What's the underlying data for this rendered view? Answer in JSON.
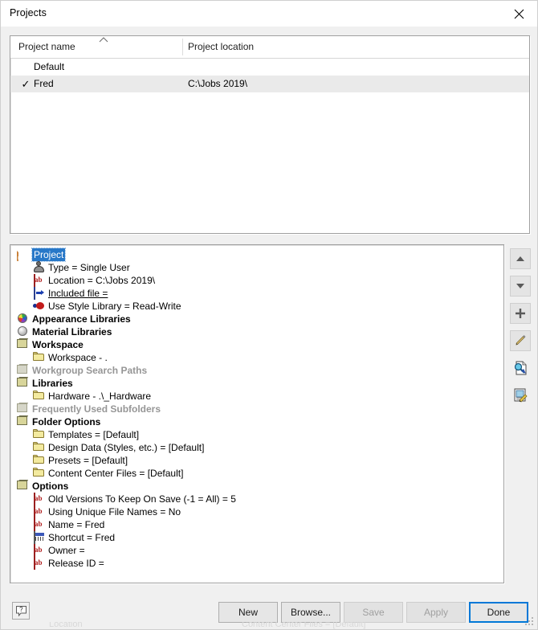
{
  "window": {
    "title": "Projects",
    "close_icon": "close-icon"
  },
  "project_list": {
    "columns": [
      "Project name",
      "Project location"
    ],
    "sort_indicator": "chevron-up-icon",
    "rows": [
      {
        "check": "",
        "name": "Default",
        "location": "",
        "selected": false
      },
      {
        "check": "✓",
        "name": "Fred",
        "location": "C:\\Jobs 2019\\",
        "selected": true
      }
    ]
  },
  "tree": {
    "nodes": [
      {
        "label": "Project",
        "indent": 0,
        "icon": "ipj-file-icon",
        "expander": "none",
        "style": "selected"
      },
      {
        "label": "Type = Single User",
        "indent": 1,
        "icon": "user-icon",
        "expander": "none",
        "style": "normal"
      },
      {
        "label": "Location = C:\\Jobs 2019\\",
        "indent": 1,
        "icon": "ab-text-icon",
        "expander": "none",
        "style": "normal"
      },
      {
        "label": "Included file =",
        "indent": 1,
        "icon": "included-file-icon",
        "expander": "none",
        "style": "link"
      },
      {
        "label": "Use Style Library = Read-Write",
        "indent": 1,
        "icon": "style-library-icon",
        "expander": "none",
        "style": "normal"
      },
      {
        "label": "Appearance Libraries",
        "indent": 0,
        "icon": "color-sphere-icon",
        "expander": "plus",
        "style": "bold"
      },
      {
        "label": "Material Libraries",
        "indent": 0,
        "icon": "gray-sphere-icon",
        "expander": "plus",
        "style": "bold"
      },
      {
        "label": "Workspace",
        "indent": 0,
        "icon": "box-icon",
        "expander": "minus",
        "style": "bold"
      },
      {
        "label": "Workspace - .",
        "indent": 1,
        "icon": "folder-icon",
        "expander": "none",
        "style": "normal"
      },
      {
        "label": "Workgroup Search Paths",
        "indent": 0,
        "icon": "box-icon-dim",
        "expander": "none",
        "style": "dim"
      },
      {
        "label": "Libraries",
        "indent": 0,
        "icon": "box-icon",
        "expander": "minus",
        "style": "bold"
      },
      {
        "label": "Hardware - .\\_Hardware",
        "indent": 1,
        "icon": "folder-icon",
        "expander": "none",
        "style": "normal"
      },
      {
        "label": "Frequently Used Subfolders",
        "indent": 0,
        "icon": "box-icon-dim",
        "expander": "none",
        "style": "dim"
      },
      {
        "label": "Folder Options",
        "indent": 0,
        "icon": "box-icon",
        "expander": "minus",
        "style": "bold"
      },
      {
        "label": "Templates = [Default]",
        "indent": 1,
        "icon": "folder-icon",
        "expander": "none",
        "style": "normal"
      },
      {
        "label": "Design Data (Styles, etc.) = [Default]",
        "indent": 1,
        "icon": "folder-icon",
        "expander": "none",
        "style": "normal"
      },
      {
        "label": "Presets = [Default]",
        "indent": 1,
        "icon": "folder-icon",
        "expander": "none",
        "style": "normal"
      },
      {
        "label": "Content Center Files = [Default]",
        "indent": 1,
        "icon": "folder-icon",
        "expander": "none",
        "style": "normal"
      },
      {
        "label": "Options",
        "indent": 0,
        "icon": "box-icon",
        "expander": "minus",
        "style": "bold"
      },
      {
        "label": "Old Versions To Keep On Save (-1 = All) = 5",
        "indent": 1,
        "icon": "ab-text-icon",
        "expander": "none",
        "style": "normal"
      },
      {
        "label": "Using Unique File Names = No",
        "indent": 1,
        "icon": "ab-text-icon",
        "expander": "none",
        "style": "normal"
      },
      {
        "label": "Name = Fred",
        "indent": 1,
        "icon": "ab-text-icon",
        "expander": "none",
        "style": "normal"
      },
      {
        "label": "Shortcut = Fred",
        "indent": 1,
        "icon": "shortcut-icon",
        "expander": "none",
        "style": "normal"
      },
      {
        "label": "Owner =",
        "indent": 1,
        "icon": "ab-text-icon",
        "expander": "none",
        "style": "normal"
      },
      {
        "label": "Release ID =",
        "indent": 1,
        "icon": "ab-text-icon",
        "expander": "none",
        "style": "normal"
      }
    ]
  },
  "sidebar": {
    "buttons": [
      {
        "name": "move-up-button",
        "icon": "triangle-up-icon",
        "enabled": true
      },
      {
        "name": "move-down-button",
        "icon": "triangle-down-icon",
        "enabled": true
      },
      {
        "name": "add-button",
        "icon": "plus-icon",
        "enabled": true
      },
      {
        "name": "edit-button",
        "icon": "pencil-icon",
        "enabled": true
      },
      {
        "name": "find-file-button",
        "icon": "search-document-icon",
        "enabled": true
      },
      {
        "name": "configure-button",
        "icon": "edit-document-icon",
        "enabled": true
      }
    ]
  },
  "footer": {
    "help_icon": "help-question-icon",
    "buttons": [
      {
        "label": "New",
        "enabled": true,
        "default": false
      },
      {
        "label": "Browse...",
        "enabled": true,
        "default": false
      },
      {
        "label": "Save",
        "enabled": false,
        "default": false
      },
      {
        "label": "Apply",
        "enabled": false,
        "default": false
      },
      {
        "label": "Done",
        "enabled": true,
        "default": true
      }
    ],
    "resize_grip": "resize-grip-icon"
  },
  "colors": {
    "dialog_bg": "#f0f0f0",
    "panel_bg": "#ffffff",
    "selection_row": "#eaeaea",
    "tree_selection": "#2878c8",
    "default_button_border": "#0078d7",
    "dim_text": "#969696"
  }
}
